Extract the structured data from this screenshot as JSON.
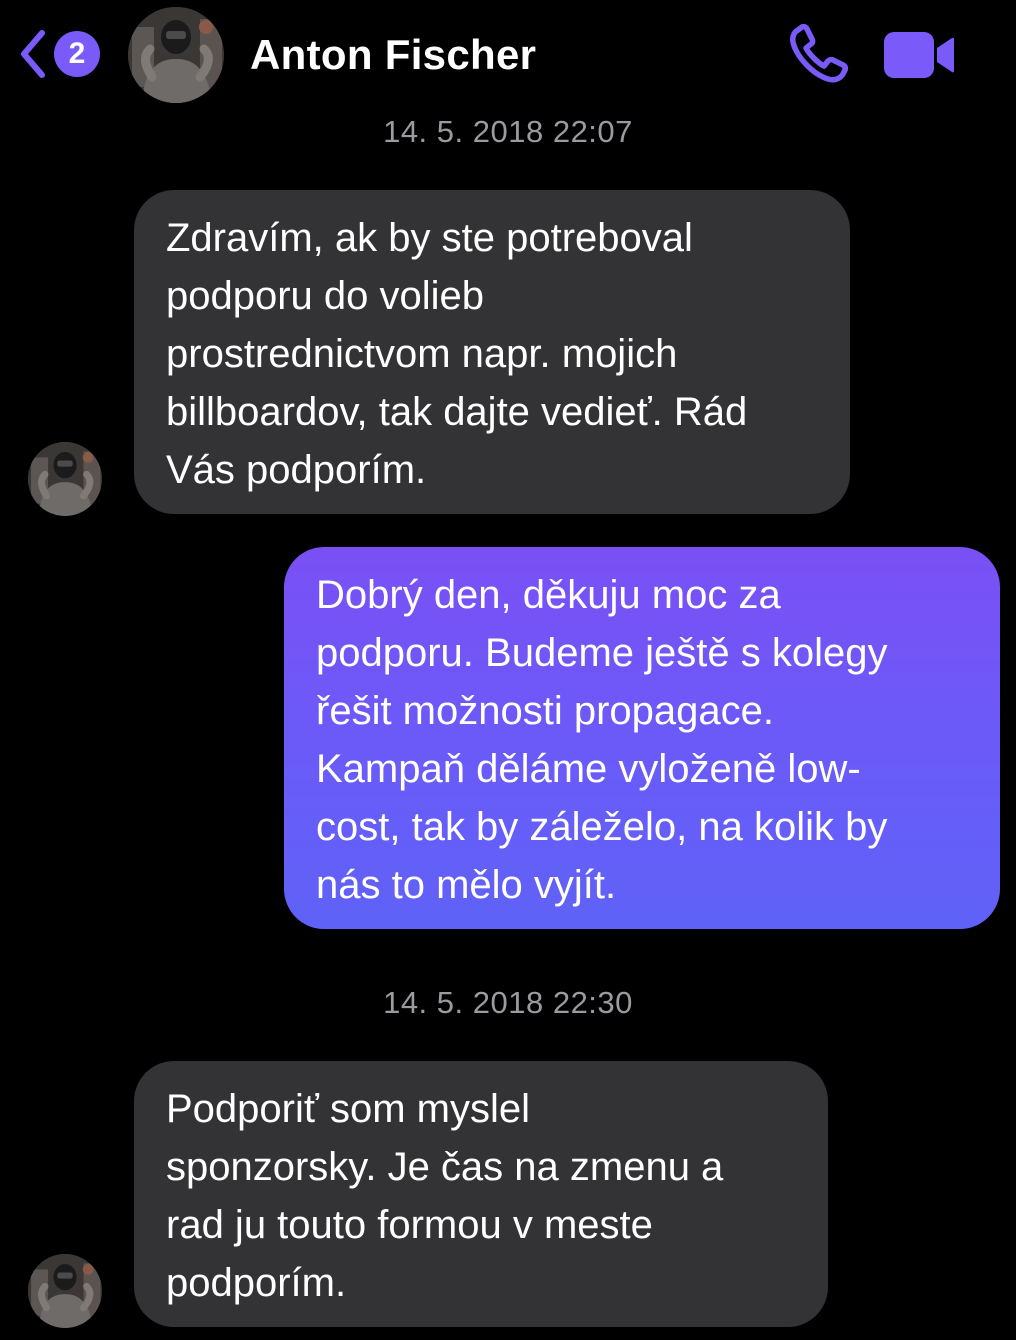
{
  "header": {
    "back_badge_count": "2",
    "contact_name": "Anton Fischer",
    "accent_color": "#7a5af8"
  },
  "conversation": {
    "groups": [
      {
        "timestamp": "14. 5. 2018 22:07",
        "messages": [
          {
            "direction": "incoming",
            "text": "Zdravím, ak by ste potreboval\npodporu do volieb\nprostrednictvom napr. mojich\nbillboardov, tak dajte vedieť. Rád\nVás podporím."
          },
          {
            "direction": "outgoing",
            "text": "Dobrý den, děkuju moc za\npodporu. Budeme ještě s kolegy\nřešit možnosti propagace.\nKampaň děláme vyloženě low-\ncost, tak by záleželo, na kolik by\nnás to mělo vyjít."
          }
        ]
      },
      {
        "timestamp": "14. 5. 2018 22:30",
        "messages": [
          {
            "direction": "incoming",
            "text": "Podporiť som myslel\nsponzorsky. Je čas na zmenu a\nrad ju touto formou v meste\npodporím."
          }
        ]
      }
    ]
  },
  "icons": {
    "back": "chevron-left-icon",
    "call": "phone-icon",
    "video": "video-camera-icon",
    "avatar": "contact-avatar"
  }
}
